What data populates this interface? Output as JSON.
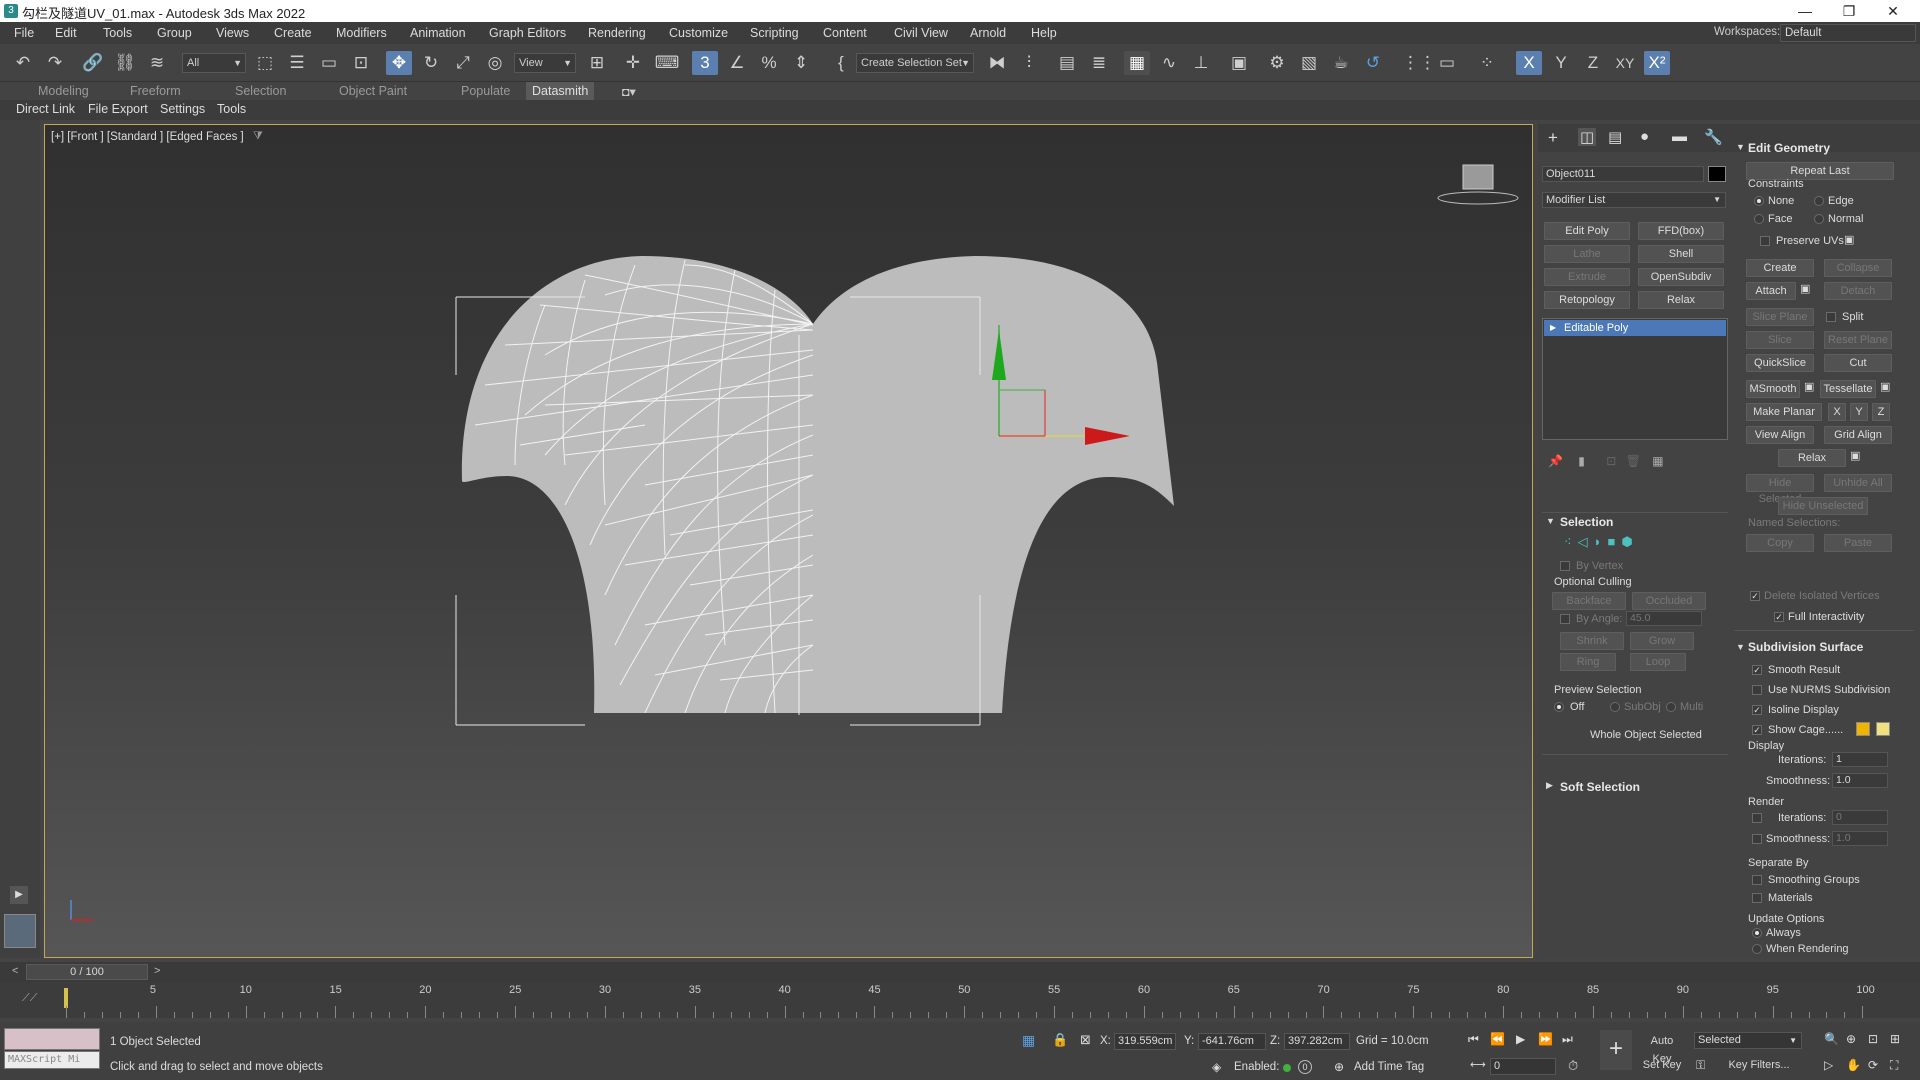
{
  "window": {
    "title": "勾栏及隧道UV_01.max - Autodesk 3ds Max 2022",
    "app_icon": "3ds-max-icon",
    "controls": [
      "minimize-icon",
      "restore-icon",
      "close-icon"
    ]
  },
  "menubar": {
    "items": [
      "File",
      "Edit",
      "Tools",
      "Group",
      "Views",
      "Create",
      "Modifiers",
      "Animation",
      "Graph Editors",
      "Rendering",
      "Customize",
      "Scripting",
      "Content",
      "Civil View",
      "Arnold",
      "Help"
    ],
    "workspaces_label": "Workspaces:",
    "workspaces_value": "Default"
  },
  "toolbar": {
    "selection_filter": "All",
    "ref_coord": "View",
    "named_selection": "Create Selection Set",
    "axis_buttons": [
      "X",
      "Y",
      "Z",
      "XY"
    ]
  },
  "ribbon": {
    "tabs": [
      "Modeling",
      "Freeform",
      "Selection",
      "Object Paint",
      "Populate",
      "Datasmith"
    ],
    "active_tab": "Datasmith"
  },
  "subtoolbar": {
    "items": [
      "Direct Link",
      "File Export",
      "Settings",
      "Tools"
    ]
  },
  "viewport": {
    "label": "[+] [Front ] [Standard ] [Edged Faces ]",
    "border_color": "#c9a45a",
    "viewcube_label": "Front"
  },
  "command_panel": {
    "object_name": "Object011",
    "object_color": "#000000",
    "modifier_list": "Modifier List",
    "modifier_buttons": [
      [
        "Edit Poly",
        "FFD(box)"
      ],
      [
        "Lathe",
        "Shell"
      ],
      [
        "Extrude",
        "OpenSubdiv"
      ],
      [
        "Retopology",
        "Relax"
      ]
    ],
    "stack_item": "Editable Poly",
    "selection": {
      "title": "Selection",
      "by_vertex": "By Vertex",
      "optional_culling": "Optional Culling",
      "backface": "Backface",
      "occluded": "Occluded",
      "by_angle": "By Angle:",
      "by_angle_value": "45.0",
      "shrink": "Shrink",
      "grow": "Grow",
      "ring": "Ring",
      "loop": "Loop",
      "preview_selection": "Preview Selection",
      "preview_off": "Off",
      "preview_subobj": "SubObj",
      "preview_multi": "Multi",
      "status": "Whole Object Selected"
    },
    "soft_selection": {
      "title": "Soft Selection"
    },
    "edit_geometry": {
      "title": "Edit Geometry",
      "repeat_last": "Repeat Last",
      "constraints": "Constraints",
      "c_none": "None",
      "c_edge": "Edge",
      "c_face": "Face",
      "c_normal": "Normal",
      "preserve_uvs": "Preserve UVs",
      "create": "Create",
      "collapse": "Collapse",
      "attach": "Attach",
      "detach": "Detach",
      "slice_plane": "Slice Plane",
      "split": "Split",
      "slice": "Slice",
      "reset_plane": "Reset Plane",
      "quickslice": "QuickSlice",
      "cut": "Cut",
      "msmooth": "MSmooth",
      "tessellate": "Tessellate",
      "make_planar": "Make Planar",
      "x": "X",
      "y": "Y",
      "z": "Z",
      "view_align": "View Align",
      "grid_align": "Grid Align",
      "relax": "Relax",
      "hide_selected": "Hide Selected",
      "unhide_all": "Unhide All",
      "hide_unselected": "Hide Unselected",
      "named_selections": "Named Selections:",
      "copy": "Copy",
      "paste": "Paste",
      "delete_isolated": "Delete Isolated Vertices",
      "full_interactivity": "Full Interactivity"
    },
    "subdivision_surface": {
      "title": "Subdivision Surface",
      "smooth_result": "Smooth Result",
      "use_nurms": "Use NURMS Subdivision",
      "isoline_display": "Isoline Display",
      "show_cage": "Show Cage......",
      "cage_color1": "#f0b400",
      "cage_color2": "#f0e080",
      "display": "Display",
      "iterations": "Iterations:",
      "iterations_value": "1",
      "smoothness": "Smoothness:",
      "smoothness_value": "1.0",
      "render": "Render",
      "r_iterations_value": "0",
      "r_smoothness_value": "1.0",
      "separate_by": "Separate By",
      "smoothing_groups": "Smoothing Groups",
      "materials": "Materials",
      "update_options": "Update Options",
      "always": "Always",
      "when_rendering": "When Rendering"
    }
  },
  "timeline": {
    "frame": "0 / 100",
    "ticks": [
      "5",
      "10",
      "15",
      "20",
      "25",
      "30",
      "35",
      "40",
      "45",
      "50",
      "55",
      "60",
      "65",
      "70",
      "75",
      "80",
      "85",
      "90",
      "95",
      "100"
    ]
  },
  "status": {
    "maxscript": "MAXScript Mi",
    "objects_selected": "1 Object Selected",
    "prompt": "Click and drag to select and move objects",
    "x_label": "X:",
    "x_value": "319.559cm",
    "y_label": "Y:",
    "y_value": "-641.76cm",
    "z_label": "Z:",
    "z_value": "397.282cm",
    "grid": "Grid = 10.0cm",
    "enabled": "Enabled:",
    "add_time_tag": "Add Time Tag",
    "auto_key": "Auto Key",
    "set_key": "Set Key",
    "selected": "Selected",
    "key_filters": "Key Filters...",
    "frame_value": "0"
  }
}
